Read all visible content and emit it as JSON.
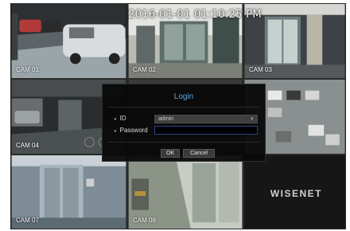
{
  "timestamp": "2016-01-01 01:10:25 PM",
  "brand": "WISENET",
  "cameras": [
    {
      "label": "CAM 01"
    },
    {
      "label": "CAM 02"
    },
    {
      "label": "CAM 03"
    },
    {
      "label": "CAM 04"
    },
    {
      "label": "CAM 07"
    },
    {
      "label": "CAM 08"
    }
  ],
  "login": {
    "title": "Login",
    "id_label": "ID",
    "id_value": "admin",
    "password_label": "Password",
    "password_value": "",
    "ok_label": "OK",
    "cancel_label": "Cancel"
  },
  "colors": {
    "title_accent": "#5aa9e6",
    "password_border": "#2f3f8c"
  }
}
